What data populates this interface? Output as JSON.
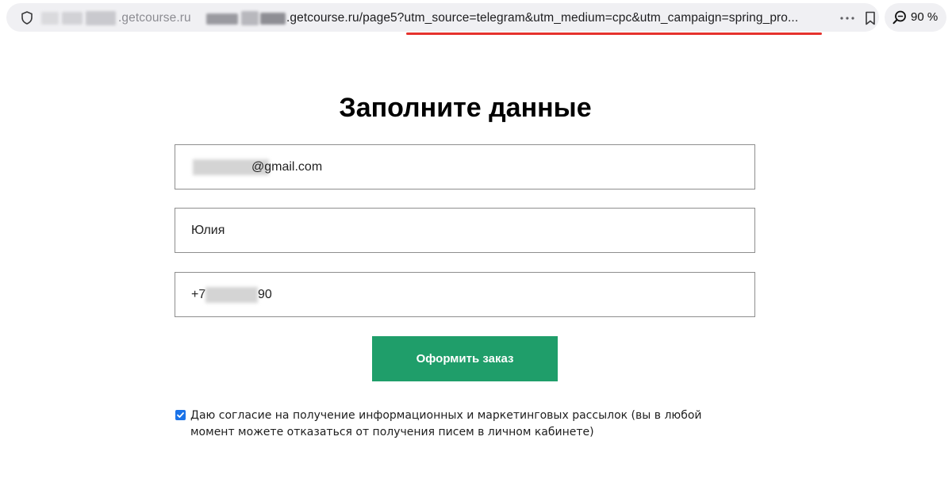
{
  "browser": {
    "url_domain_visible": ".getcourse.ru",
    "url_main_visible": ".getcourse.ru/page5?utm_source=telegram&utm_medium=cpc&utm_campaign=spring_pro...",
    "zoom": "90 %",
    "underline_color": "#e5322d"
  },
  "icons": {
    "shield": "shield-icon",
    "more": "more-icon",
    "bookmark": "bookmark-icon",
    "zoom": "zoom-icon",
    "checkbox": "checkbox-checked-icon"
  },
  "form": {
    "title": "Заполните данные",
    "email_suffix": "@gmail.com",
    "name_value": "Юлия",
    "phone_prefix": "+7",
    "phone_suffix": "90",
    "submit_label": "Оформить заказ",
    "submit_color": "#1f9e6a",
    "consent_checked": true,
    "consent_text": "Даю согласие на получение информационных и маркетинговых рассылок (вы в любой момент можете отказаться от получения писем в личном кабинете)"
  }
}
